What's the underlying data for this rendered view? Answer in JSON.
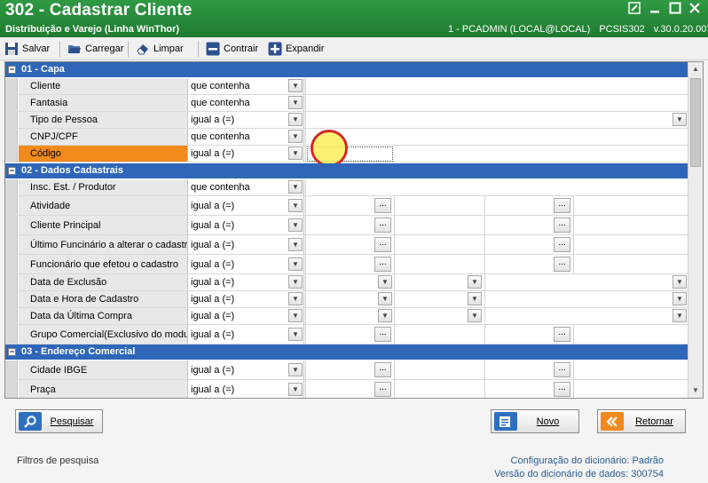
{
  "window": {
    "title": "302 - Cadastrar Cliente",
    "subtitle": "Distribuição e Varejo (Linha WinThor)",
    "user": "1 - PCADMIN (LOCAL@LOCAL)",
    "routine": "PCSIS302",
    "version": "v.30.0.20.007",
    "accent": "#2a8c3c"
  },
  "toolbar": {
    "salvar": "Salvar",
    "carregar": "Carregar",
    "limpar": "Limpar",
    "contrair": "Contrair",
    "expandir": "Expandir"
  },
  "groups": [
    {
      "title": "01 - Capa",
      "rows": [
        {
          "label": "Cliente",
          "op": "que contenha"
        },
        {
          "label": "Fantasia",
          "op": "que contenha"
        },
        {
          "label": "Tipo de Pessoa",
          "op": "igual a (=)"
        },
        {
          "label": "CNPJ/CPF",
          "op": "que contenha"
        },
        {
          "label": "Código",
          "op": "igual a (=)"
        }
      ]
    },
    {
      "title": "02 - Dados Cadastrais",
      "rows": [
        {
          "label": "Insc. Est. / Produtor",
          "op": "que contenha"
        },
        {
          "label": "Atividade",
          "op": "igual a (=)"
        },
        {
          "label": "Cliente Principal",
          "op": "igual a (=)"
        },
        {
          "label": "Último Funcinário a alterar o cadastro",
          "op": "igual a (=)"
        },
        {
          "label": "Funcionário que efetou o cadastro",
          "op": "igual a (=)"
        },
        {
          "label": "Data de Exclusão",
          "op": "igual a (=)"
        },
        {
          "label": "Data e Hora de Cadastro",
          "op": "igual a (=)"
        },
        {
          "label": "Data da Última Compra",
          "op": "igual a (=)"
        },
        {
          "label": "Grupo Comercial(Exclusivo do modulo)",
          "op": "igual a (=)"
        }
      ]
    },
    {
      "title": "03 - Endereço Comercial",
      "rows": [
        {
          "label": "Cidade IBGE",
          "op": "igual a (=)"
        },
        {
          "label": "Praça",
          "op": "igual a (=)"
        }
      ]
    }
  ],
  "buttons": {
    "pesquisar": "Pesquisar",
    "novo": "Novo",
    "retornar": "Retornar"
  },
  "footer": {
    "status": "Filtros de pesquisa",
    "config_label": "Configuração do dicionário:",
    "config_value": "Padrão",
    "version_label": "Versão do dicionário de dados:",
    "version_value": "300754"
  }
}
